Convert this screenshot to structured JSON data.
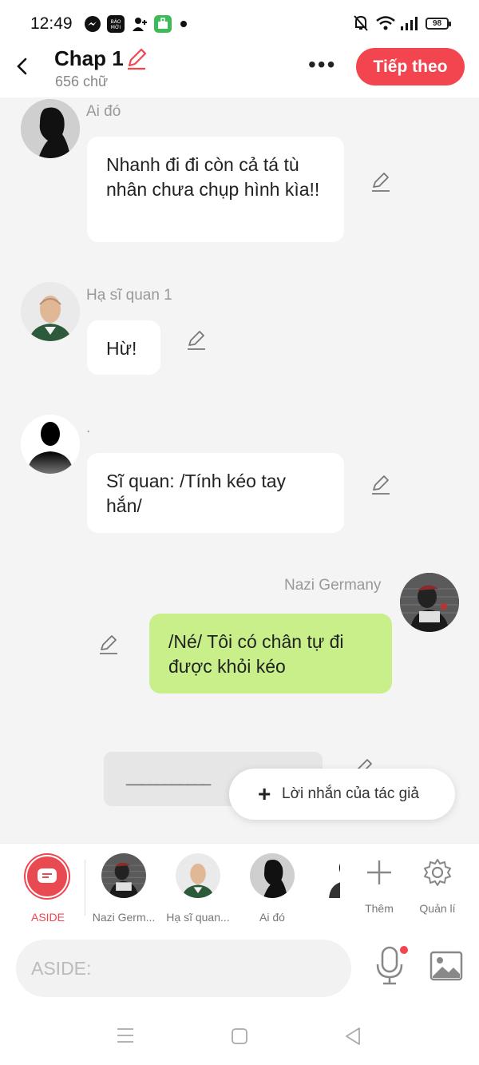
{
  "status_bar": {
    "time": "12:49",
    "battery": "98",
    "icons": [
      "messenger-icon",
      "baomoi-icon",
      "add-user-icon",
      "store-icon",
      "bell-off-icon",
      "wifi-icon",
      "signal-icon"
    ]
  },
  "header": {
    "title": "Chap 1",
    "word_count": "656 chữ",
    "next_label": "Tiếp theo",
    "accent": "#f2454f"
  },
  "messages": [
    {
      "sender": "Ai đó",
      "text": "Nhanh đi đi còn cả tá tù nhân chưa chụp hình kìa!!"
    },
    {
      "sender": "Hạ sĩ quan 1",
      "text": "Hừ!"
    },
    {
      "sender": ".",
      "text": "Sĩ quan: /Tính kéo tay hắn/"
    },
    {
      "sender": "Nazi Germany",
      "text": "/Né/ Tôi có chân tự đi được khỏi kéo",
      "mine": true
    },
    {
      "sender": "",
      "text": "___________"
    }
  ],
  "author_note_label": "Lời nhắn của tác giả",
  "character_bar": {
    "items": [
      {
        "label": "ASIDE"
      },
      {
        "label": "Nazi Germ..."
      },
      {
        "label": "Hạ sĩ quan..."
      },
      {
        "label": "Ai đó"
      }
    ],
    "more_label": "Thêm",
    "manage_label": "Quản lí"
  },
  "input": {
    "placeholder": "ASIDE:"
  }
}
